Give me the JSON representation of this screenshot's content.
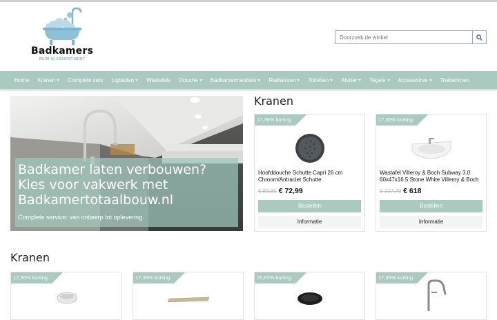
{
  "brand": {
    "name": "Badkamers",
    "tagline": "RUIM IN ASSORTIMENT"
  },
  "search": {
    "placeholder": "Doorzoek de winkel"
  },
  "nav": [
    {
      "label": "Home",
      "dropdown": false
    },
    {
      "label": "Kranen",
      "dropdown": true
    },
    {
      "label": "Complete sets",
      "dropdown": false
    },
    {
      "label": "Ligbaden",
      "dropdown": true
    },
    {
      "label": "Wastafels",
      "dropdown": false
    },
    {
      "label": "Douche",
      "dropdown": true
    },
    {
      "label": "Badkamermeubels",
      "dropdown": true
    },
    {
      "label": "Radiatoren",
      "dropdown": true
    },
    {
      "label": "Toiletten",
      "dropdown": true
    },
    {
      "label": "Afvoer",
      "dropdown": true
    },
    {
      "label": "Tegels",
      "dropdown": true
    },
    {
      "label": "Accessoires",
      "dropdown": true
    },
    {
      "label": "Toebehoren",
      "dropdown": false
    }
  ],
  "hero": {
    "title": "Badkamer laten verbouwen? Kies voor vakwerk met Badkamertotaalbouw.nl",
    "subtitle": "Complete service: van ontwerp tot oplevering"
  },
  "featured": {
    "title": "Kranen",
    "products": [
      {
        "badge": "17,36% korting",
        "name": "Hoofddouche Schutte Capri 26 cm Chroom/Antraciet Schutte",
        "old_price": "€ 88,35",
        "price": "€ 72,99",
        "buy_label": "Bestellen",
        "info_label": "Informatie",
        "image": "round-shower-head"
      },
      {
        "badge": "17,36% korting",
        "name": "Wastafel Villeroy & Boch Subway 3.0 60x47x16.5 Stone White Villeroy & Boch",
        "old_price": "€ 747,79",
        "price": "€ 618",
        "buy_label": "Bestellen",
        "info_label": "Informatie",
        "image": "washbasin"
      }
    ]
  },
  "section2": {
    "title": "Kranen",
    "products": [
      {
        "badge": "17,36% korting",
        "image": "vessel-sink"
      },
      {
        "badge": "17,36% korting",
        "image": "shelf"
      },
      {
        "badge": "25,62% korting",
        "image": "black-bowl"
      },
      {
        "badge": "17,36% korting",
        "image": "floor-tap"
      }
    ]
  },
  "colors": {
    "accent": "#a9c9c1",
    "logo_blue": "#7fb4cf"
  }
}
